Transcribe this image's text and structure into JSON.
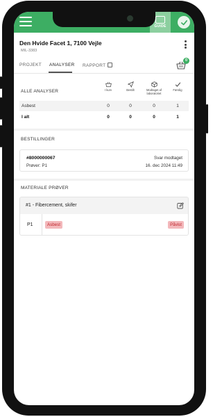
{
  "header": {
    "guide_label": "GUIDE"
  },
  "case": {
    "address": "Den Hvide Facet 1, 7100 Vejle",
    "id": "MIL-3383"
  },
  "tabs": [
    {
      "label": "PROJEKT"
    },
    {
      "label": "ANALYSER"
    },
    {
      "label": "RAPPORT"
    }
  ],
  "basket_count": "0",
  "analyser": {
    "title": "ALLE ANALYSER",
    "columns": [
      {
        "label": "I kurv",
        "icon": "basket-icon"
      },
      {
        "label": "Bestilt",
        "icon": "send-icon"
      },
      {
        "label": "Modtaget af laboratoriet",
        "icon": "box-icon"
      },
      {
        "label": "Færdig",
        "icon": "check-icon"
      }
    ],
    "rows": [
      {
        "name": "Asbest",
        "values": [
          "0",
          "0",
          "0",
          "1"
        ]
      },
      {
        "name": "I alt",
        "values": [
          "0",
          "0",
          "0",
          "1"
        ]
      }
    ]
  },
  "orders": {
    "title": "BESTILLINGER",
    "items": [
      {
        "number": "#8000000067",
        "samples": "Prøver: P1",
        "status": "Svar modtaget",
        "date": "16. dec 2024 11:49"
      }
    ]
  },
  "materials": {
    "title": "MATERIALE PRØVER",
    "items": [
      {
        "title": "#1 - Fibercement, skifer",
        "sample": "P1",
        "analysis": "Asbest",
        "result": "Påvist"
      }
    ]
  },
  "colors": {
    "brand_green": "#3dae63",
    "tag_bg": "#f3b8bb",
    "tag_text": "#c0282e"
  }
}
